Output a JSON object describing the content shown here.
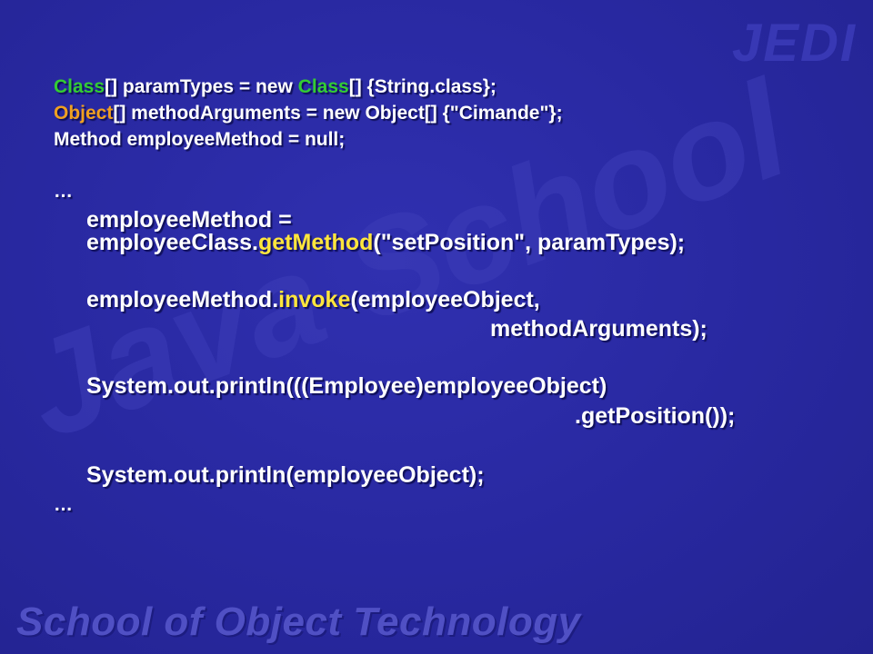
{
  "watermark": {
    "corner": "JEDI",
    "swirl": "Java School"
  },
  "footer_text": "School of Object Technology",
  "code": {
    "l1": {
      "kw1": "Class",
      "a": "[] paramTypes = new ",
      "kw2": "Class",
      "b": "[] {String.class};"
    },
    "l2": {
      "kw1": "Object",
      "a": "[] methodArguments = new Object[] {\"Cimande\"};"
    },
    "l3": "Method employeeMethod = null;",
    "ellipsis1": "…",
    "l4": "employeeMethod =",
    "l5": {
      "a": "employeeClass.",
      "kw": "getMethod",
      "b": "(\"setPosition\", paramTypes);"
    },
    "l6": {
      "a": "employeeMethod.",
      "kw": "invoke",
      "b": "(employeeObject,"
    },
    "l7": "methodArguments);",
    "l8": "System.out.println(((Employee)employeeObject)",
    "l9": ".getPosition());",
    "l10": "System.out.println(employeeObject);",
    "ellipsis2": "…"
  },
  "colors": {
    "background": "#2a2aa0",
    "keyword_green": "#33cc33",
    "keyword_orange": "#f0a020",
    "method_yellow": "#ffe63c",
    "text": "#ffffff"
  }
}
